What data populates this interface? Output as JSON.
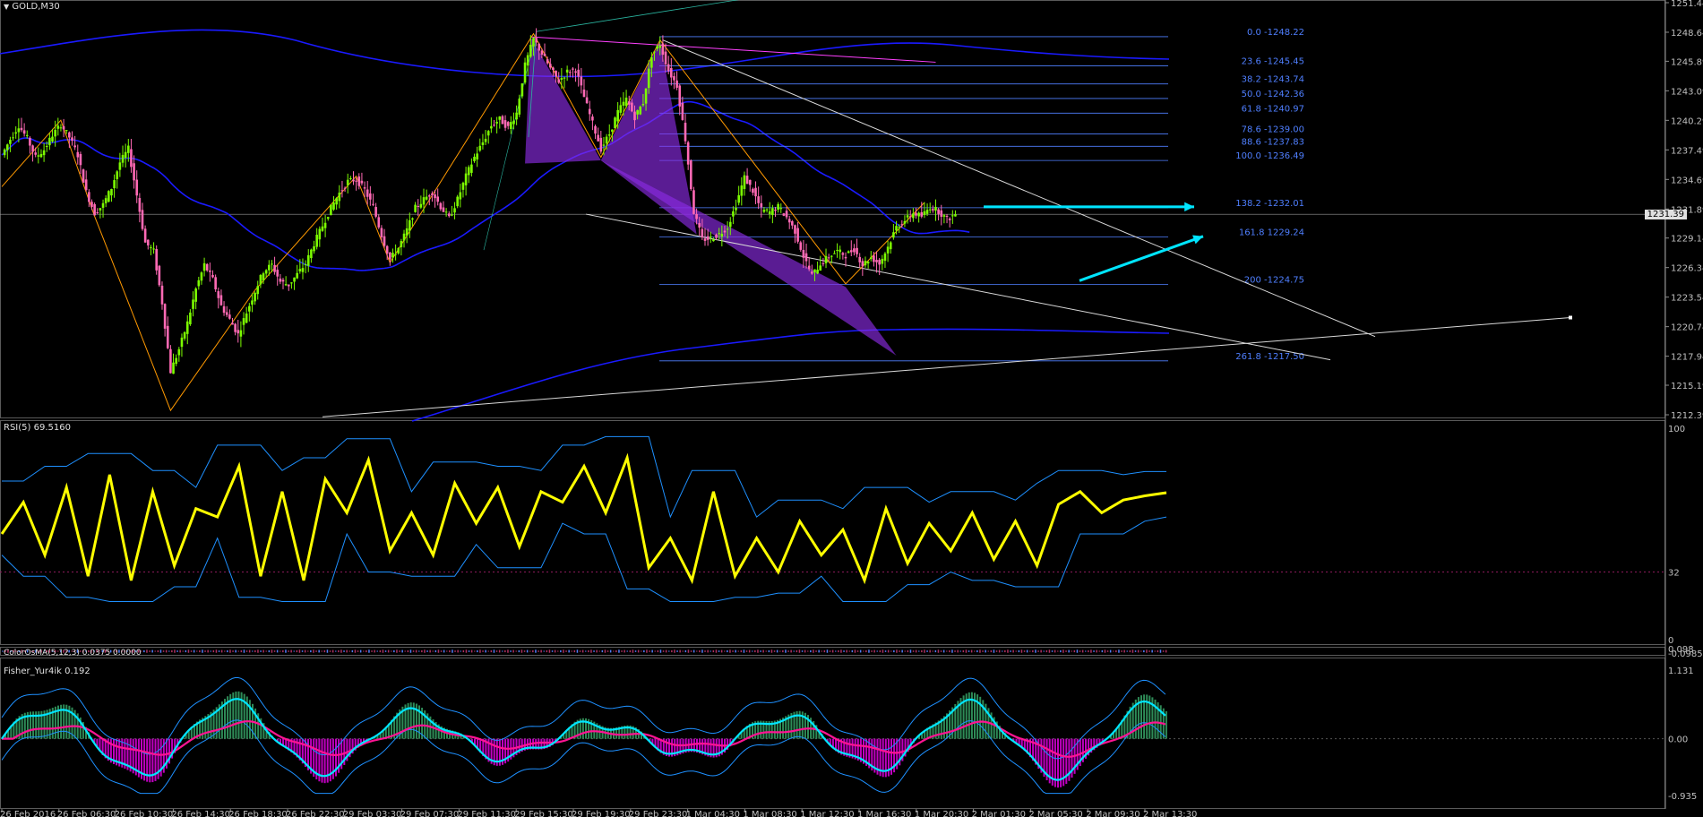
{
  "window": {
    "title": "GOLD,M30"
  },
  "panels": {
    "rsi": {
      "title": "RSI(5) 69.5160",
      "levels": [
        "100",
        "32",
        "0"
      ]
    },
    "osma": {
      "title": "ColorOsMA(5,12,3) 0.0375 0.0000",
      "levels": [
        "0.098",
        "-0.0985"
      ]
    },
    "fisher": {
      "title": "Fisher_Yur4ik 0.192",
      "levels": [
        "1.131",
        "0.00",
        "-0.935"
      ]
    }
  },
  "price_axis": [
    "1251.44",
    "1248.64",
    "1245.89",
    "1243.09",
    "1240.29",
    "1237.49",
    "1234.69",
    "1231.89",
    "1229.14",
    "1226.34",
    "1223.54",
    "1220.74",
    "1217.94",
    "1215.19",
    "1212.39"
  ],
  "current_price": "1231.39",
  "time_axis": [
    "26 Feb 2016",
    "26 Feb 06:30",
    "26 Feb 10:30",
    "26 Feb 14:30",
    "26 Feb 18:30",
    "26 Feb 22:30",
    "29 Feb 03:30",
    "29 Feb 07:30",
    "29 Feb 11:30",
    "29 Feb 15:30",
    "29 Feb 19:30",
    "29 Feb 23:30",
    "1 Mar 04:30",
    "1 Mar 08:30",
    "1 Mar 12:30",
    "1 Mar 16:30",
    "1 Mar 20:30",
    "2 Mar 01:30",
    "2 Mar 05:30",
    "2 Mar 09:30",
    "2 Mar 13:30"
  ],
  "fib_labels": [
    {
      "label": "0.0 -1248.22",
      "price": 1248.22
    },
    {
      "label": "23.6 -1245.45",
      "price": 1245.45
    },
    {
      "label": "38.2 -1243.74",
      "price": 1243.74
    },
    {
      "label": "50.0 -1242.36",
      "price": 1242.36
    },
    {
      "label": "61.8 -1240.97",
      "price": 1240.97
    },
    {
      "label": "78.6 -1239.00",
      "price": 1239.0
    },
    {
      "label": "88.6 -1237.83",
      "price": 1237.83
    },
    {
      "label": "100.0 -1236.49",
      "price": 1236.49
    },
    {
      "label": "138.2 -1232.01",
      "price": 1232.01
    },
    {
      "label": "161.8 1229.24",
      "price": 1229.24
    },
    {
      "label": "200 -1224.75",
      "price": 1224.75
    },
    {
      "label": "261.8 -1217.50",
      "price": 1217.5
    }
  ],
  "colors": {
    "background": "#000000",
    "bull": "#7cfc00",
    "bear": "#ff69b4",
    "ma": "#1a1aff",
    "fib": "#4f7fff",
    "rsi": "#ffff00",
    "band": "#1e90ff",
    "fisher_fast": "#00e5ff",
    "fisher_slow": "#ff1493",
    "hist_pos": "#2e8b57",
    "hist_neg": "#c000c0",
    "pattern": "#8a2be2",
    "arrow": "#00e5ff"
  },
  "chart_data": {
    "type": "candlestick",
    "symbol": "GOLD",
    "timeframe": "M30",
    "ylim": [
      1212.39,
      1251.44
    ],
    "close_path": [
      [
        0,
        1237.0
      ],
      [
        3,
        1238.5
      ],
      [
        6,
        1239.8
      ],
      [
        9,
        1238.6
      ],
      [
        12,
        1236.8
      ],
      [
        15,
        1237.5
      ],
      [
        18,
        1238.9
      ],
      [
        21,
        1239.9
      ],
      [
        24,
        1238.7
      ],
      [
        27,
        1237.0
      ],
      [
        30,
        1233.5
      ],
      [
        33,
        1231.5
      ],
      [
        36,
        1232.3
      ],
      [
        39,
        1233.9
      ],
      [
        42,
        1236.3
      ],
      [
        45,
        1237.6
      ],
      [
        48,
        1233.2
      ],
      [
        51,
        1228.7
      ],
      [
        54,
        1227.9
      ],
      [
        57,
        1223.0
      ],
      [
        60,
        1216.5
      ],
      [
        63,
        1218.6
      ],
      [
        66,
        1221.1
      ],
      [
        69,
        1224.3
      ],
      [
        72,
        1226.6
      ],
      [
        75,
        1225.2
      ],
      [
        78,
        1222.7
      ],
      [
        81,
        1221.4
      ],
      [
        84,
        1220.0
      ],
      [
        87,
        1222.1
      ],
      [
        90,
        1224.1
      ],
      [
        93,
        1226.0
      ],
      [
        96,
        1226.6
      ],
      [
        99,
        1225.0
      ],
      [
        102,
        1224.7
      ],
      [
        105,
        1225.7
      ],
      [
        108,
        1226.7
      ],
      [
        111,
        1228.6
      ],
      [
        114,
        1230.3
      ],
      [
        117,
        1232.0
      ],
      [
        120,
        1233.4
      ],
      [
        123,
        1234.5
      ],
      [
        126,
        1234.7
      ],
      [
        129,
        1233.7
      ],
      [
        132,
        1232.1
      ],
      [
        135,
        1229.4
      ],
      [
        138,
        1227.1
      ],
      [
        141,
        1228.2
      ],
      [
        144,
        1229.9
      ],
      [
        147,
        1232.0
      ],
      [
        150,
        1232.8
      ],
      [
        153,
        1233.5
      ],
      [
        156,
        1232.1
      ],
      [
        159,
        1231.0
      ],
      [
        162,
        1232.8
      ],
      [
        165,
        1235.0
      ],
      [
        168,
        1236.8
      ],
      [
        171,
        1238.2
      ],
      [
        174,
        1239.8
      ],
      [
        177,
        1240.4
      ],
      [
        180,
        1239.6
      ],
      [
        183,
        1241.0
      ],
      [
        186,
        1245.5
      ],
      [
        189,
        1248.0
      ],
      [
        192,
        1246.6
      ],
      [
        195,
        1245.2
      ],
      [
        198,
        1244.0
      ],
      [
        201,
        1244.9
      ],
      [
        204,
        1245.1
      ],
      [
        207,
        1242.5
      ],
      [
        210,
        1240.0
      ],
      [
        213,
        1237.6
      ],
      [
        216,
        1239.0
      ],
      [
        219,
        1241.1
      ],
      [
        222,
        1242.3
      ],
      [
        225,
        1240.6
      ],
      [
        228,
        1242.0
      ],
      [
        231,
        1246.5
      ],
      [
        234,
        1247.5
      ],
      [
        237,
        1245.0
      ],
      [
        240,
        1243.6
      ],
      [
        243,
        1238.5
      ],
      [
        246,
        1231.6
      ],
      [
        249,
        1229.0
      ],
      [
        252,
        1229.1
      ],
      [
        255,
        1229.5
      ],
      [
        258,
        1230.2
      ],
      [
        261,
        1232.3
      ],
      [
        264,
        1234.9
      ],
      [
        267,
        1233.6
      ],
      [
        270,
        1231.8
      ],
      [
        273,
        1231.6
      ],
      [
        276,
        1232.1
      ],
      [
        279,
        1231.1
      ],
      [
        282,
        1229.8
      ],
      [
        285,
        1227.4
      ],
      [
        288,
        1225.6
      ],
      [
        291,
        1226.7
      ],
      [
        294,
        1227.4
      ],
      [
        297,
        1227.9
      ],
      [
        300,
        1227.5
      ],
      [
        303,
        1228.1
      ],
      [
        306,
        1226.6
      ],
      [
        309,
        1227.3
      ],
      [
        312,
        1226.7
      ],
      [
        315,
        1228.3
      ],
      [
        318,
        1230.2
      ],
      [
        321,
        1230.8
      ],
      [
        324,
        1231.5
      ],
      [
        327,
        1231.2
      ],
      [
        330,
        1232.1
      ],
      [
        333,
        1231.7
      ],
      [
        336,
        1230.9
      ],
      [
        339,
        1231.4
      ]
    ],
    "rsi": {
      "values": [
        50,
        65,
        40,
        72,
        30,
        78,
        28,
        70,
        35,
        62,
        58,
        82,
        30,
        70,
        28,
        76,
        60,
        85,
        42,
        60,
        40,
        74,
        55,
        72,
        44,
        70,
        65,
        82,
        60,
        86,
        34,
        48,
        28,
        70,
        30,
        48,
        32,
        56,
        40,
        52,
        28,
        62,
        36,
        55,
        42,
        60,
        38,
        56,
        35,
        64,
        70,
        60,
        66,
        68,
        69.5
      ],
      "levels": [
        0,
        32,
        100
      ]
    },
    "fisher": {
      "value": 0.192,
      "ylim": [
        -0.935,
        1.131
      ]
    },
    "osma": {
      "value": 0.0375
    }
  }
}
